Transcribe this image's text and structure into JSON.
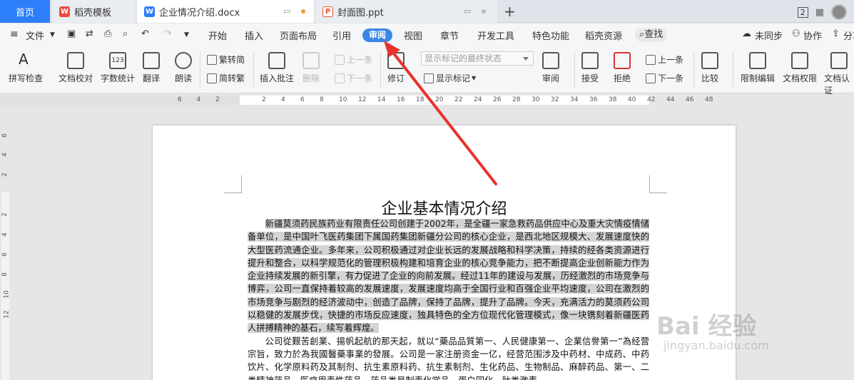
{
  "tabs": {
    "home": "首页",
    "wps": "稻壳模板",
    "doc": "企业情况介绍.docx",
    "ppt": "封面图.ppt",
    "window_count": "2"
  },
  "menu": {
    "file": "文件",
    "items": [
      "开始",
      "插入",
      "页面布局",
      "引用",
      "审阅",
      "视图",
      "章节",
      "开发工具",
      "特色功能",
      "稻壳资源"
    ],
    "search": "查找",
    "sync": "未同步",
    "collab": "协作",
    "share": "分享"
  },
  "ribbon": {
    "spell_check": "拼写检查",
    "doc_proof": "文档校对",
    "word_count": "字数统计",
    "translate": "翻译",
    "read_aloud": "朗读",
    "trad_to_simp": "繁转简",
    "simp_to_trad": "简转繁",
    "insert_comment": "插入批注",
    "delete": "删除",
    "prev_comment": "上一条",
    "next_comment": "下一条",
    "revise": "修订",
    "mark_state": "显示标记的最终状态",
    "show_markup": "显示标记",
    "review": "审阅",
    "accept": "接受",
    "reject": "拒绝",
    "prev_change": "上一条",
    "next_change": "下一条",
    "compare": "比较",
    "restrict_edit": "限制编辑",
    "doc_rights": "文档权限",
    "doc_cert": "文档认证"
  },
  "ruler": {
    "h_ticks": [
      "6",
      "4",
      "2",
      "2",
      "4",
      "6",
      "8",
      "10",
      "12",
      "14",
      "16",
      "18",
      "20",
      "22",
      "24",
      "26",
      "28",
      "30",
      "32",
      "34",
      "36",
      "38",
      "40",
      "42",
      "44",
      "46",
      "48"
    ],
    "v_ticks": [
      "6",
      "4",
      "2",
      "2",
      "4",
      "6",
      "8",
      "10",
      "12"
    ]
  },
  "document": {
    "title": "企业基本情况介绍",
    "paragraph1": "新疆莫须药民族药业有限责任公司创建于2002年，是全疆一家急救药品供应中心及重大灾情疫情储备单位，是中国叶飞医药集团下属国药集团新疆分公司的核心企业，是西北地区规模大、发展速度快的大型医药流通企业。多年来，公司积极通过对企业长远的发展战略和科学决策，持续的经各类资源进行提升和整合，以科学规范化的管理积极构建和培育企业的核心竞争能力，把不断提高企业创新能力作为企业持续发展的新引擎，有力促进了企业的向前发展。经过11年的建设与发展，历经激烈的市场竞争与博弈，公司一直保持着较高的发展速度，发展速度均高于全国行业和百强企业平均速度，公司在激烈的市场竞争与剧烈的经济波动中，创造了品牌，保持了品牌，提升了品牌。今天，充满活力的莫须药公司以稳健的发展步伐，快捷的市场反应速度，独具特色的全方位现代化管理模式，像一块镌刻着新疆医药人拼搏精神的基石，续写着辉煌。",
    "paragraph2": "公司從艱苦創業、揚帆起航的那天起，就以“藥品品質第一、人民健康第一、企業信譽第一”為经营宗旨，致力於為我國醫藥事業的發展。公司是一家注册资金一亿，经营范围涉及中药材、中成药、中药饮片、化学原料药及其制剂、抗生素原料药、抗生素制剂、生化药品、生物制品、麻醉药品、第一、二类精神药品、医疗用毒性药品、药品类易制毒化学品、蛋白同化、肽类激素、"
  },
  "watermark": {
    "brand": "Bai 经验",
    "url": "jingyan.baidu.com"
  },
  "colors": {
    "accent": "#3a85e8",
    "home_tab": "#2d7ff9",
    "arrow": "#e8322b",
    "selection": "#d4d4d4"
  }
}
